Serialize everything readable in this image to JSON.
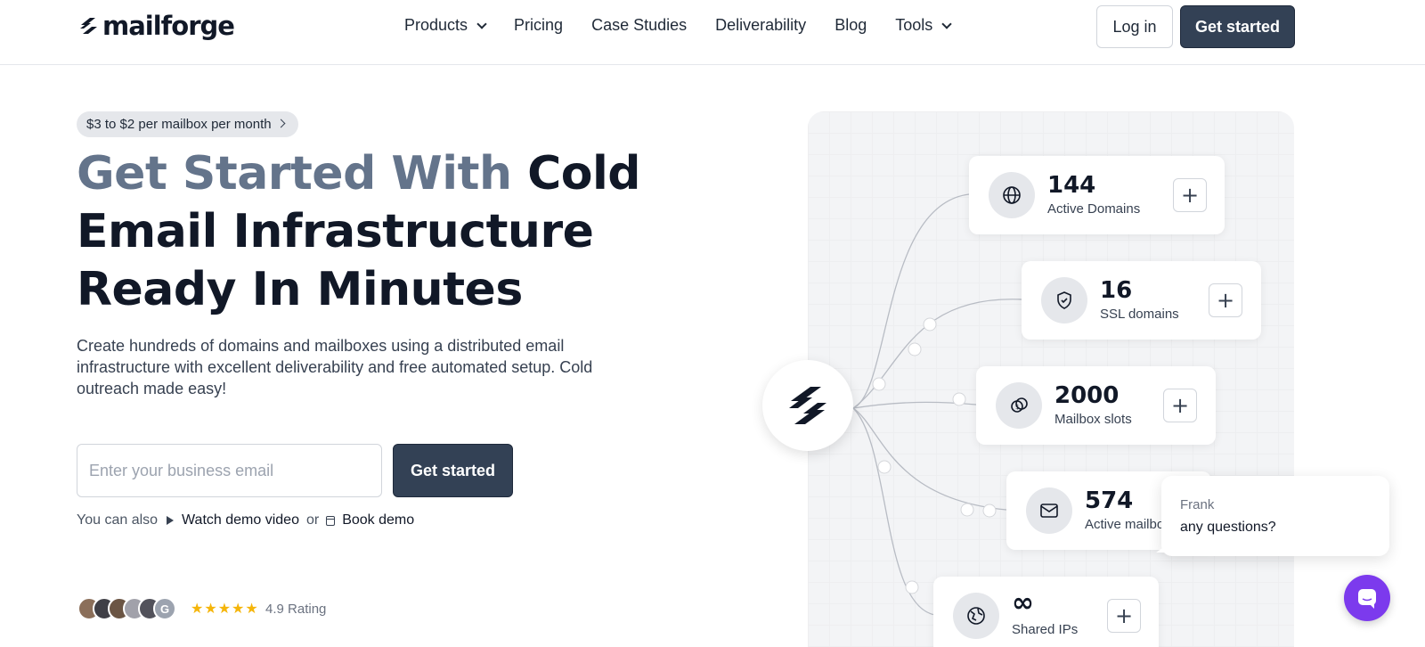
{
  "brand": {
    "name": "mailforge"
  },
  "nav": {
    "items": [
      {
        "label": "Products",
        "dropdown": true
      },
      {
        "label": "Pricing",
        "dropdown": false
      },
      {
        "label": "Case Studies",
        "dropdown": false
      },
      {
        "label": "Deliverability",
        "dropdown": false
      },
      {
        "label": "Blog",
        "dropdown": false
      },
      {
        "label": "Tools",
        "dropdown": true
      }
    ],
    "login_label": "Log in",
    "cta_label": "Get started"
  },
  "hero": {
    "promo": "$3 to $2 per mailbox per month",
    "headline_muted": "Get Started With",
    "headline_strong": "Cold Email Infrastructure Ready In Minutes",
    "subtext": "Create hundreds of domains and mailboxes using a distributed email infrastructure with excellent deliverability and free automated setup. Cold outreach made easy!",
    "email_placeholder": "Enter your business email",
    "cta_label": "Get started",
    "also_prefix": "You can also",
    "watch_demo": "Watch demo video",
    "or": "or",
    "book_demo": "Book demo",
    "rating_stars": "★★★★★",
    "rating_text": "4.9 Rating",
    "avatar_g": "G"
  },
  "stats": [
    {
      "value": "144",
      "label": "Active Domains",
      "icon": "globe-icon"
    },
    {
      "value": "16",
      "label": "SSL domains",
      "icon": "shield-check-icon"
    },
    {
      "value": "2000",
      "label": "Mailbox slots",
      "icon": "mailbox-slots-icon"
    },
    {
      "value": "574",
      "label": "Active mailboxes",
      "icon": "mail-icon"
    },
    {
      "value": "∞",
      "label": "Shared IPs",
      "icon": "ip-globe-icon"
    }
  ],
  "chat": {
    "agent": "Frank",
    "message": "any questions?"
  },
  "colors": {
    "primary_dark": "#334155",
    "muted_heading": "#64748b",
    "star": "#f5b50a",
    "chat_fab": "#7c3aed"
  }
}
